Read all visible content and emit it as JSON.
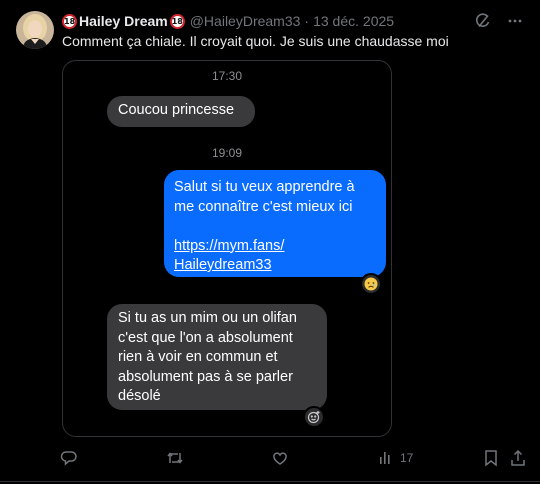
{
  "author": {
    "badge_left": "18",
    "display_name": "Hailey Dream",
    "badge_right": "18",
    "handle": "@HaileyDream33",
    "separator": "·",
    "date": "13 déc. 2025"
  },
  "tweet": {
    "text": "Comment ça chiale. Il croyait quoi. Je suis une chaudasse moi"
  },
  "conversation": {
    "time_1": "17:30",
    "message_1": "Coucou princesse",
    "time_2": "19:09",
    "message_2_line_1": "Salut si tu veux apprendre à",
    "message_2_line_2": "me connaître c'est mieux ici",
    "message_2_link_1": "https://mym.fans/",
    "message_2_link_2": "Haileydream33",
    "message_3_line_1": "Si tu as un mim ou un olifan",
    "message_3_line_2": "c'est que l'on a absolument",
    "message_3_line_3": "rien à voir en commun et",
    "message_3_line_4": "absolument pas à se parler",
    "message_3_line_5": "désolé",
    "colors": {
      "outgoing": "#0a6cff",
      "incoming": "#3a3a3c"
    }
  },
  "actions": {
    "views_count": "17"
  },
  "icons": {
    "grok": "grok-icon",
    "more": "more-icon",
    "reply": "reply-icon",
    "retweet": "retweet-icon",
    "like": "like-icon",
    "views": "views-icon",
    "bookmark": "bookmark-icon",
    "share": "share-icon"
  }
}
